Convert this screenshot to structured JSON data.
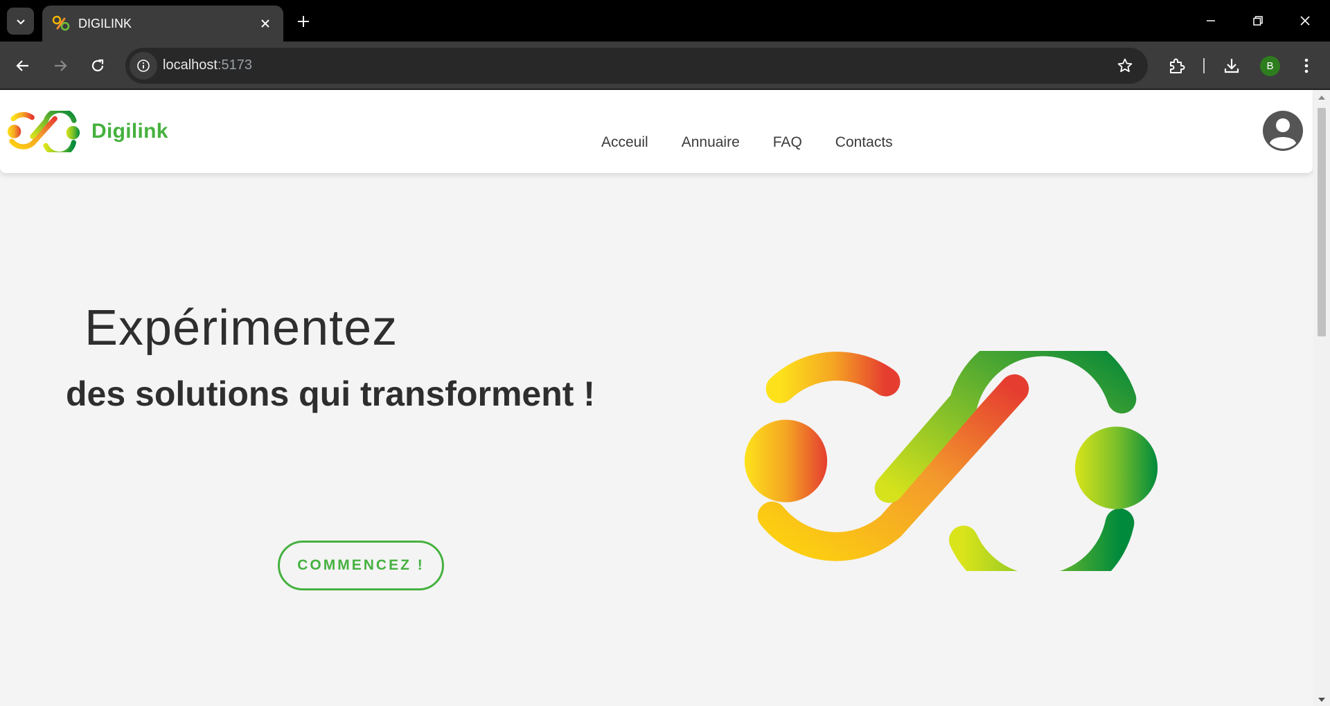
{
  "browser": {
    "tab_title": "DIGILINK",
    "url_host": "localhost",
    "url_port": ":5173",
    "profile_initial": "B"
  },
  "site": {
    "brand_name": "Digilink",
    "brand_color": "#45b13f",
    "nav": [
      "Acceuil",
      "Annuaire",
      "FAQ",
      "Contacts"
    ]
  },
  "hero": {
    "headline": "Expérimentez",
    "subheadline": "des solutions qui transforment !",
    "cta_label": "COMMENCEZ !"
  }
}
